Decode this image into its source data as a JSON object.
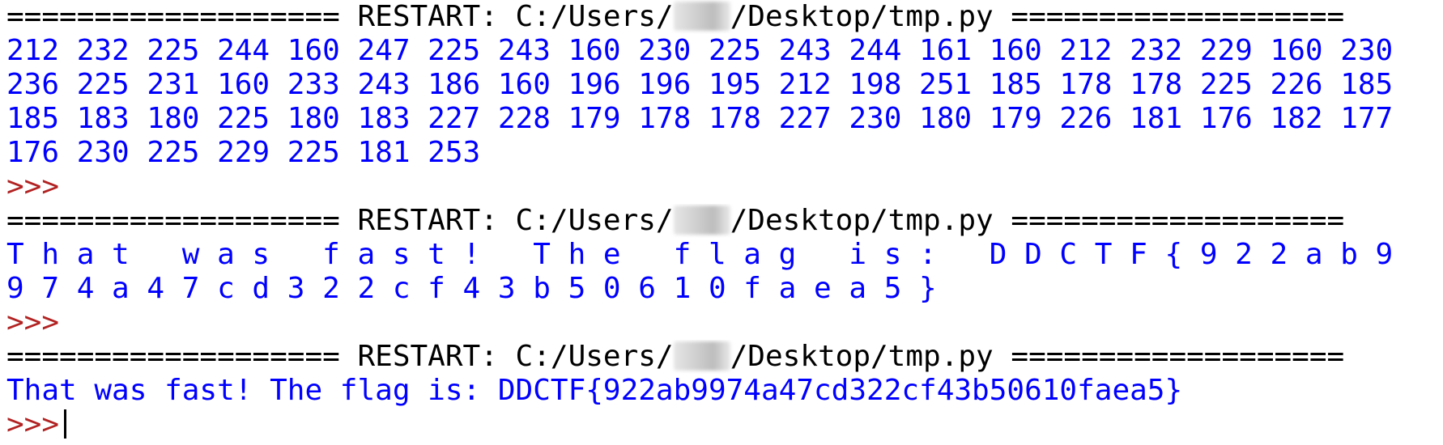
{
  "shell": {
    "restart_left": "=================== RESTART: C:/Users/",
    "restart_right": "/Desktop/tmp.py ===================",
    "prompt": ">>>",
    "outputs": [
      [
        "212 232 225 244 160 247 225 243 160 230 225 243 244 161 160 212 232 229 160 230",
        "236 225 231 160 233 243 186 160 196 196 195 212 198 251 185 178 178 225 226 185",
        "185 183 180 225 180 183 227 228 179 178 178 227 230 180 179 226 181 176 182 177",
        "176 230 225 229 225 181 253"
      ],
      [
        "T h a t   w a s   f a s t !   T h e   f l a g   i s :   D D C T F { 9 2 2 a b 9",
        "9 7 4 a 4 7 c d 3 2 2 c f 4 3 b 5 0 6 1 0 f a e a 5 }"
      ],
      [
        "That was fast! The flag is: DDCTF{922ab9974a47cd322cf43b50610faea5}"
      ]
    ]
  },
  "colors": {
    "output": "#0000ff",
    "prompt": "#b22222",
    "restart": "#000000",
    "background": "#ffffff"
  }
}
